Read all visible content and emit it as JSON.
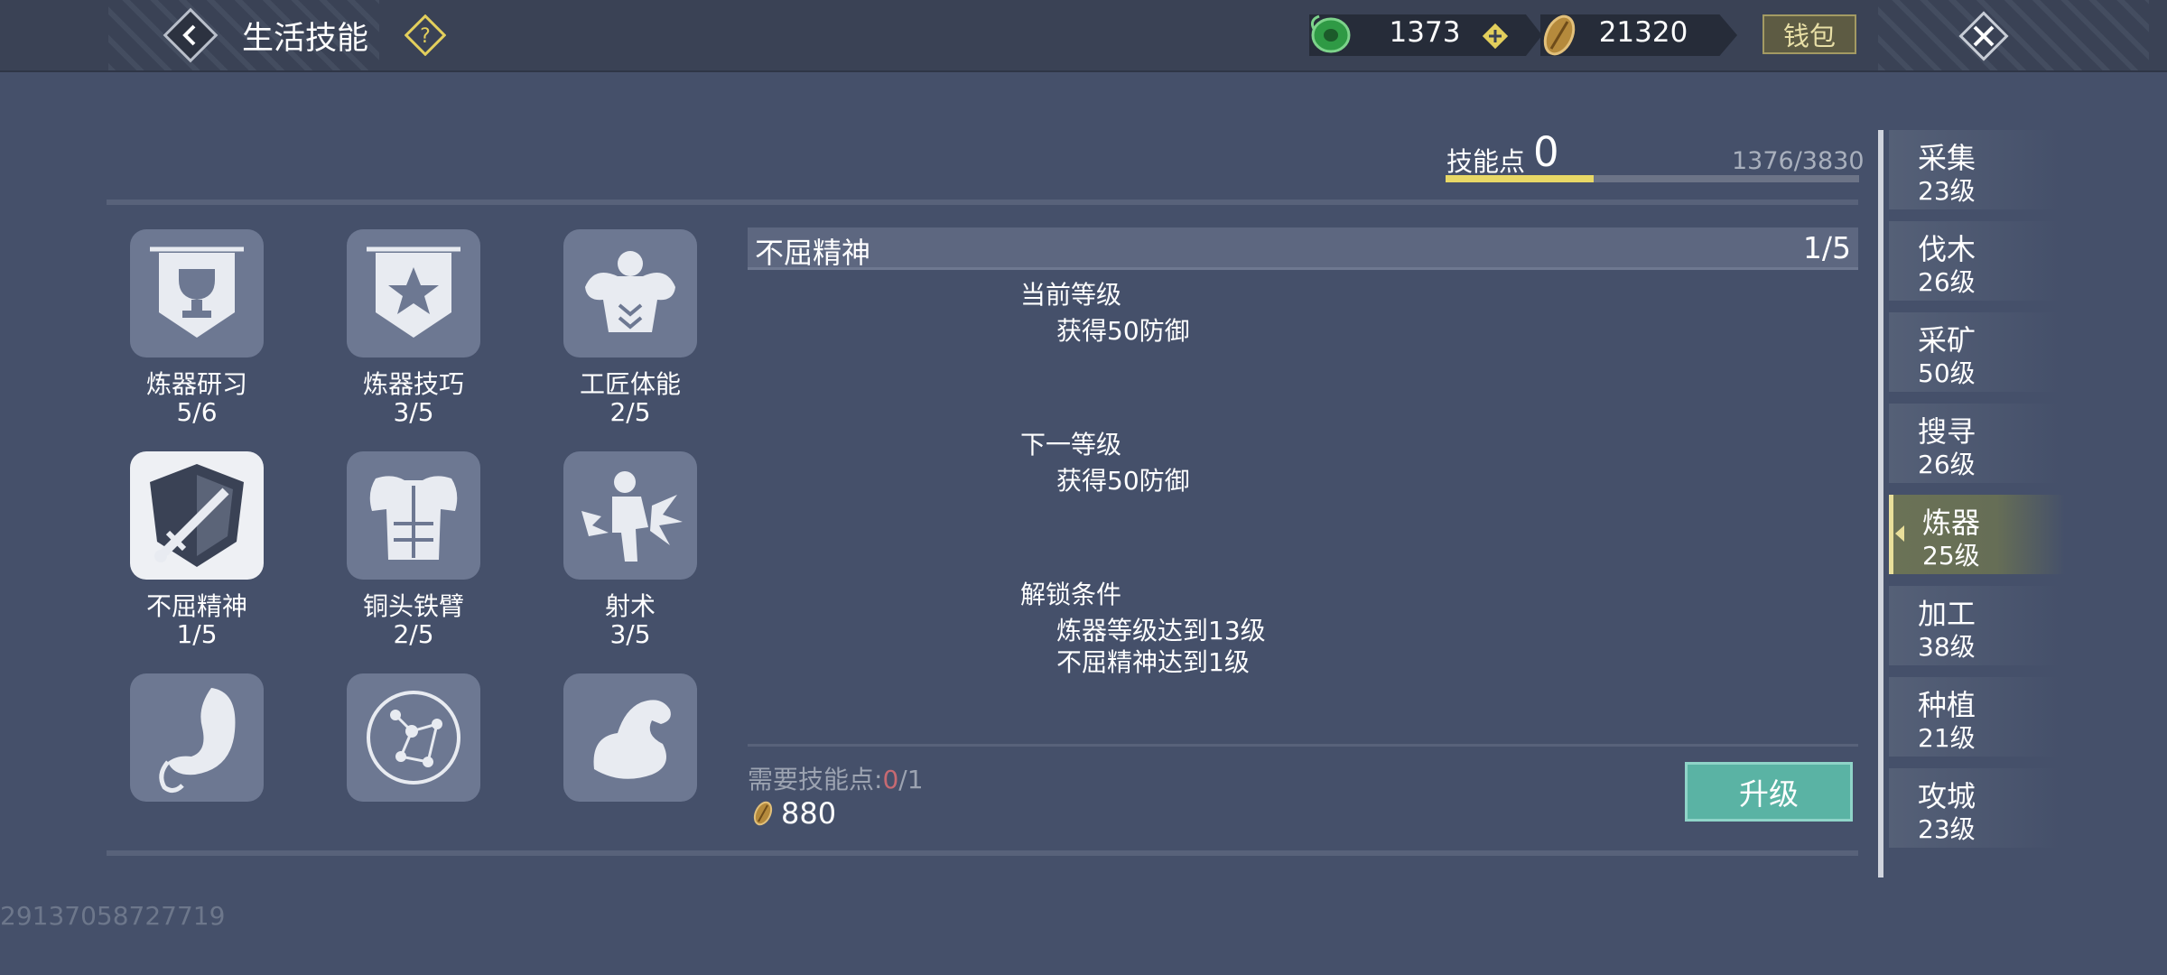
{
  "header": {
    "title": "生活技能",
    "currency1": "1373",
    "currency2": "21320",
    "wallet_label": "钱包"
  },
  "skill_points": {
    "label": "技能点",
    "value": "0",
    "progress_text": "1376/3830",
    "progress_fraction": 0.359
  },
  "skills": [
    {
      "name": "炼器研习",
      "level": "5/6",
      "icon": "trophy-banner-icon"
    },
    {
      "name": "炼器技巧",
      "level": "3/5",
      "icon": "star-banner-icon"
    },
    {
      "name": "工匠体能",
      "level": "2/5",
      "icon": "muscular-torso-icon"
    },
    {
      "name": "不屈精神",
      "level": "1/5",
      "icon": "sword-shield-icon",
      "selected": true
    },
    {
      "name": "铜头铁臂",
      "level": "2/5",
      "icon": "armor-torso-icon"
    },
    {
      "name": "射术",
      "level": "3/5",
      "icon": "impact-icon"
    },
    {
      "name": "",
      "level": "",
      "icon": "stomach-icon"
    },
    {
      "name": "",
      "level": "",
      "icon": "constellation-icon"
    },
    {
      "name": "",
      "level": "",
      "icon": "flexed-arm-icon"
    }
  ],
  "detail": {
    "name": "不屈精神",
    "level": "1/5",
    "current_label": "当前等级",
    "current_effect": "获得50防御",
    "next_label": "下一等级",
    "next_effect": "获得50防御",
    "unlock_label": "解锁条件",
    "unlock_cond1": "炼器等级达到13级",
    "unlock_cond2": "不屈精神达到1级",
    "required_label": "需要技能点:",
    "required_current": "0",
    "required_total": "/1",
    "cost": "880",
    "upgrade_label": "升级"
  },
  "categories": [
    {
      "name": "采集",
      "level": "23级"
    },
    {
      "name": "伐木",
      "level": "26级"
    },
    {
      "name": "采矿",
      "level": "50级"
    },
    {
      "name": "搜寻",
      "level": "26级"
    },
    {
      "name": "炼器",
      "level": "25级",
      "active": true
    },
    {
      "name": "加工",
      "level": "38级"
    },
    {
      "name": "种植",
      "level": "21级"
    },
    {
      "name": "攻城",
      "level": "23级"
    }
  ],
  "uid": "29137058727719",
  "colors": {
    "background": "#45506a",
    "accent_yellow": "#e8d866",
    "upgrade_green": "#5ab3a4"
  }
}
